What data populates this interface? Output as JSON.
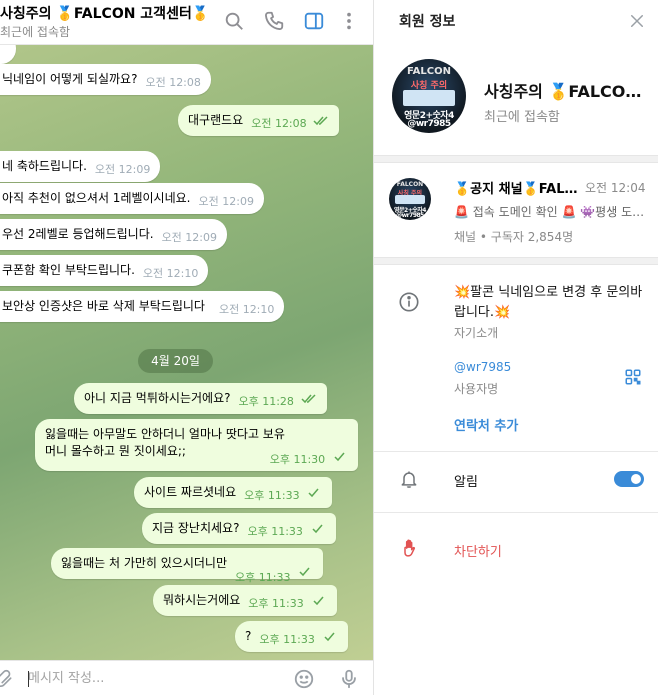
{
  "chat": {
    "title": "사칭주의 🥇FALCON 고객센터🥇",
    "status": "최근에 접속함",
    "messages": [
      {
        "dir": "in",
        "text": "닉네임이 어떻게 되실까요?",
        "time": "오전 12:08"
      },
      {
        "dir": "out",
        "text": "대구랜드요",
        "time": "오전 12:08",
        "read": true
      },
      {
        "dir": "in",
        "text": "네 축하드립니다.",
        "time": "오전 12:09"
      },
      {
        "dir": "in",
        "text": "아직 추천이 없으셔서 1레벨이시네요.",
        "time": "오전 12:09"
      },
      {
        "dir": "in",
        "text": "우선 2레벨로 등업해드립니다.",
        "time": "오전 12:09"
      },
      {
        "dir": "in",
        "text": "쿠폰함 확인 부탁드립니다.",
        "time": "오전 12:10"
      },
      {
        "dir": "in",
        "text": "보안상 인증샷은 바로 삭제 부탁드립니다",
        "time": "오전 12:10"
      },
      {
        "dir": "out",
        "text": "아니 지금 먹튀하시는거에요?",
        "time": "오후 11:28",
        "read": true
      },
      {
        "dir": "out",
        "text": "잃을때는 아무말도 안하더니 얼마나 땃다고 보유머니 몰수하고 뭔 짓이세요;;",
        "time": "오후 11:30",
        "read": false
      },
      {
        "dir": "out",
        "text": "사이트 짜르셧네요",
        "time": "오후 11:33",
        "read": false
      },
      {
        "dir": "out",
        "text": "지금 장난치세요?",
        "time": "오후 11:33",
        "read": false
      },
      {
        "dir": "out",
        "text": "잃을때는 처 가만히 있으시더니만",
        "time": "오후 11:33",
        "read": false
      },
      {
        "dir": "out",
        "text": "뭐하시는거에요",
        "time": "오후 11:33",
        "read": false
      },
      {
        "dir": "out",
        "text": "?",
        "time": "오후 11:33",
        "read": false
      }
    ],
    "date_divider": "4월 20일",
    "composer_placeholder": "메시지 작성..."
  },
  "panel": {
    "title": "회원 정보",
    "profile": {
      "name": "사칭주의 🥇FALCON 고객센터🥇",
      "status": "최근에 접속함",
      "avatar": {
        "top": "FALCON",
        "sub": "사칭 주의",
        "bottom": "영문2+숫자4",
        "handle": "@wr7985"
      }
    },
    "channel": {
      "name": "🥇공지 채널🥇FALCON",
      "time": "오전 12:04",
      "preview": "🚨 접속 도메인 확인 🚨 👾평생 도메인",
      "subtitle": "채널 • 구독자 2,854명"
    },
    "bio": "💥팔콘 닉네임으로 변경 후 문의바랍니다.💥",
    "bio_label": "자기소개",
    "username": "@wr7985",
    "username_label": "사용자명",
    "add_contact": "연락처 추가",
    "notifications_label": "알림",
    "notifications_on": true,
    "block_label": "차단하기"
  },
  "colors": {
    "accent": "#3a8bd8",
    "outgoing_bubble": "#effdde",
    "danger": "#e25353"
  }
}
